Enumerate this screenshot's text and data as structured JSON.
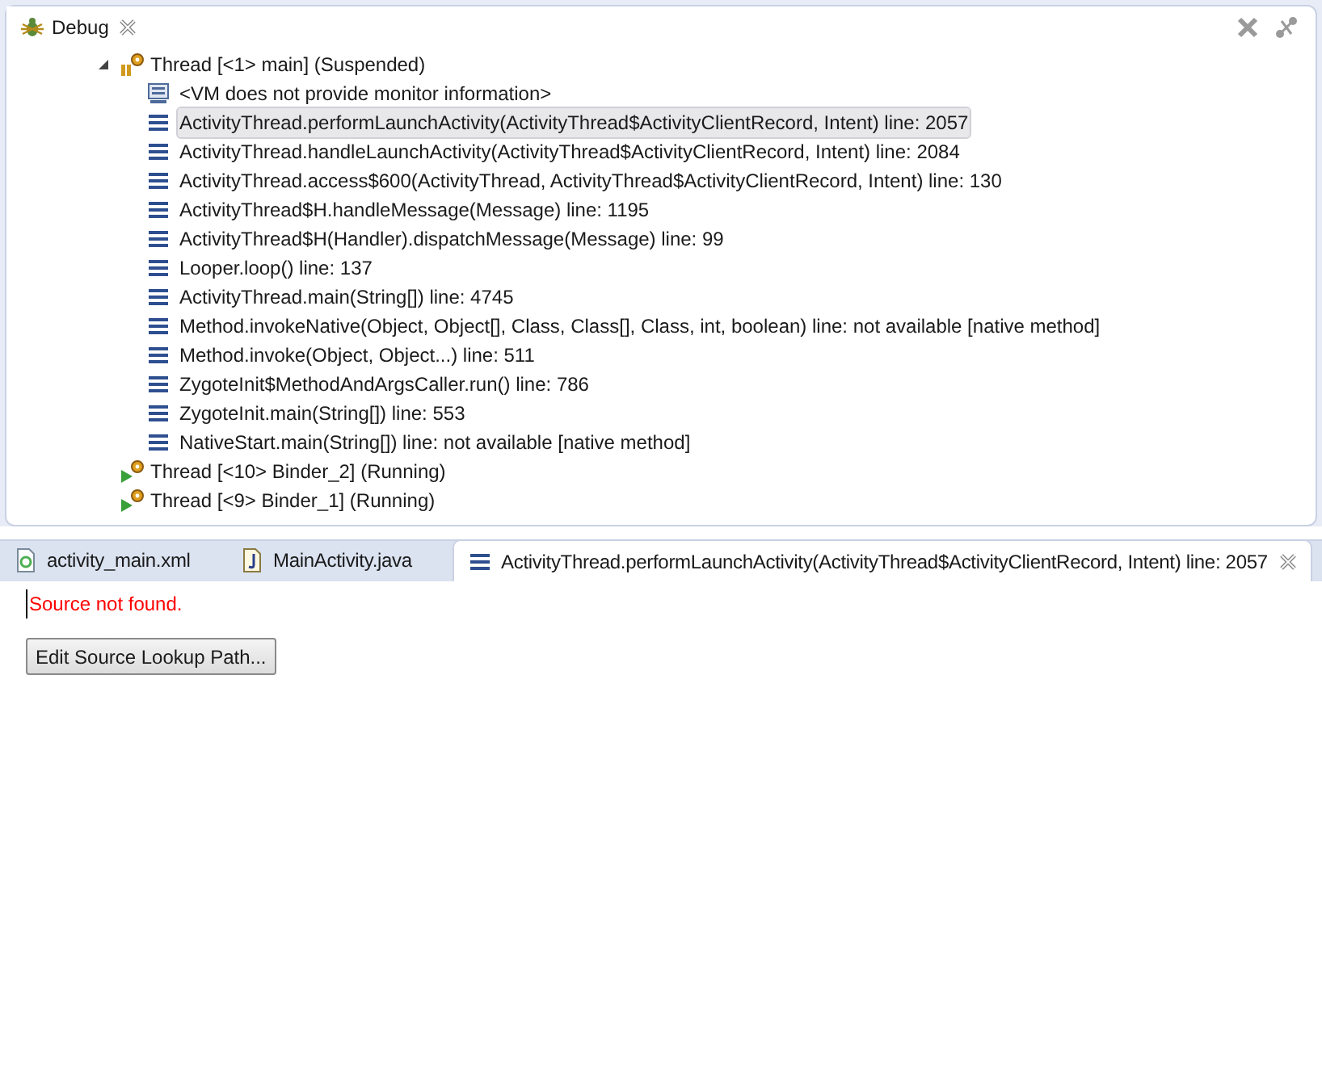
{
  "debug_view": {
    "tab": {
      "title": "Debug",
      "selected": true
    },
    "threads": [
      {
        "label": "Thread [<1> main] (Suspended)",
        "kind": "suspended",
        "expanded": true,
        "children": [
          {
            "kind": "monitor",
            "label": "<VM does not provide monitor information>",
            "selected": false
          },
          {
            "kind": "frame",
            "label": "ActivityThread.performLaunchActivity(ActivityThread$ActivityClientRecord, Intent) line: 2057",
            "selected": true
          },
          {
            "kind": "frame",
            "label": "ActivityThread.handleLaunchActivity(ActivityThread$ActivityClientRecord, Intent) line: 2084",
            "selected": false
          },
          {
            "kind": "frame",
            "label": "ActivityThread.access$600(ActivityThread, ActivityThread$ActivityClientRecord, Intent) line: 130",
            "selected": false
          },
          {
            "kind": "frame",
            "label": "ActivityThread$H.handleMessage(Message) line: 1195",
            "selected": false
          },
          {
            "kind": "frame",
            "label": "ActivityThread$H(Handler).dispatchMessage(Message) line: 99",
            "selected": false
          },
          {
            "kind": "frame",
            "label": "Looper.loop() line: 137",
            "selected": false
          },
          {
            "kind": "frame",
            "label": "ActivityThread.main(String[]) line: 4745",
            "selected": false
          },
          {
            "kind": "frame",
            "label": "Method.invokeNative(Object, Object[], Class, Class[], Class, int, boolean) line: not available [native method]",
            "selected": false
          },
          {
            "kind": "frame",
            "label": "Method.invoke(Object, Object...) line: 511",
            "selected": false
          },
          {
            "kind": "frame",
            "label": "ZygoteInit$MethodAndArgsCaller.run() line: 786",
            "selected": false
          },
          {
            "kind": "frame",
            "label": "ZygoteInit.main(String[]) line: 553",
            "selected": false
          },
          {
            "kind": "frame",
            "label": "NativeStart.main(String[]) line: not available [native method]",
            "selected": false
          }
        ]
      },
      {
        "label": "Thread [<10> Binder_2] (Running)",
        "kind": "running"
      },
      {
        "label": "Thread [<9> Binder_1] (Running)",
        "kind": "running"
      }
    ]
  },
  "editor": {
    "tabs": [
      {
        "kind": "xml",
        "label": "activity_main.xml",
        "selected": false
      },
      {
        "kind": "java",
        "label": "MainActivity.java",
        "selected": false
      },
      {
        "kind": "frame",
        "label": "ActivityThread.performLaunchActivity(ActivityThread$ActivityClientRecord, Intent) line: 2057",
        "selected": true
      }
    ],
    "message": "Source not found.",
    "button": "Edit Source Lookup Path..."
  }
}
